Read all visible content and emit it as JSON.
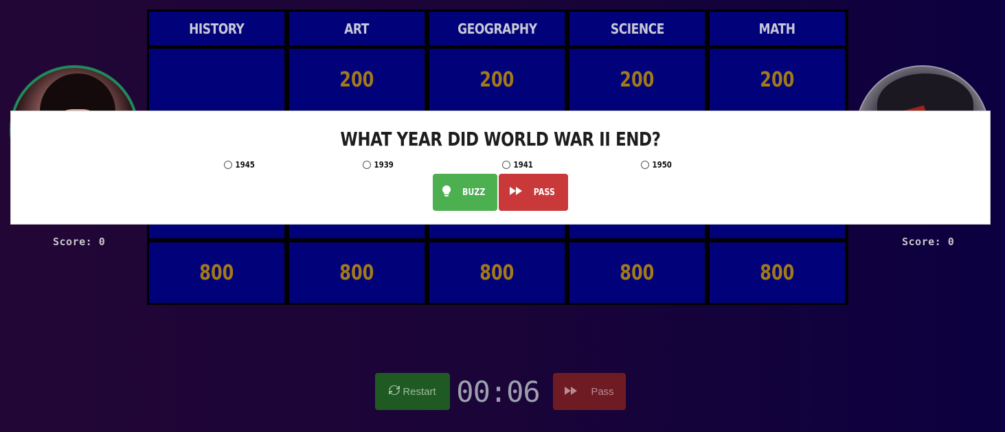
{
  "board": {
    "categories": [
      "HISTORY",
      "ART",
      "GEOGRAPHY",
      "SCIENCE",
      "MATH"
    ],
    "row_200": [
      "",
      "200",
      "200",
      "200",
      "200"
    ],
    "row_800": [
      "800",
      "800",
      "800",
      "800",
      "800"
    ]
  },
  "players": {
    "left_score": "Score: 0",
    "right_score": "Score: 0"
  },
  "question_modal": {
    "question": "WHAT YEAR DID WORLD WAR II END?",
    "options": [
      "1945",
      "1939",
      "1941",
      "1950"
    ],
    "buzz_label": "BUZZ",
    "pass_label": "PASS"
  },
  "controls": {
    "restart_label": "Restart",
    "timer": "00:06",
    "pass_label": "Pass"
  },
  "colors": {
    "board_cell": "#01027a",
    "value_gold": "#a27a18",
    "buzz_green": "#4caf50",
    "pass_red": "#c9393a"
  }
}
